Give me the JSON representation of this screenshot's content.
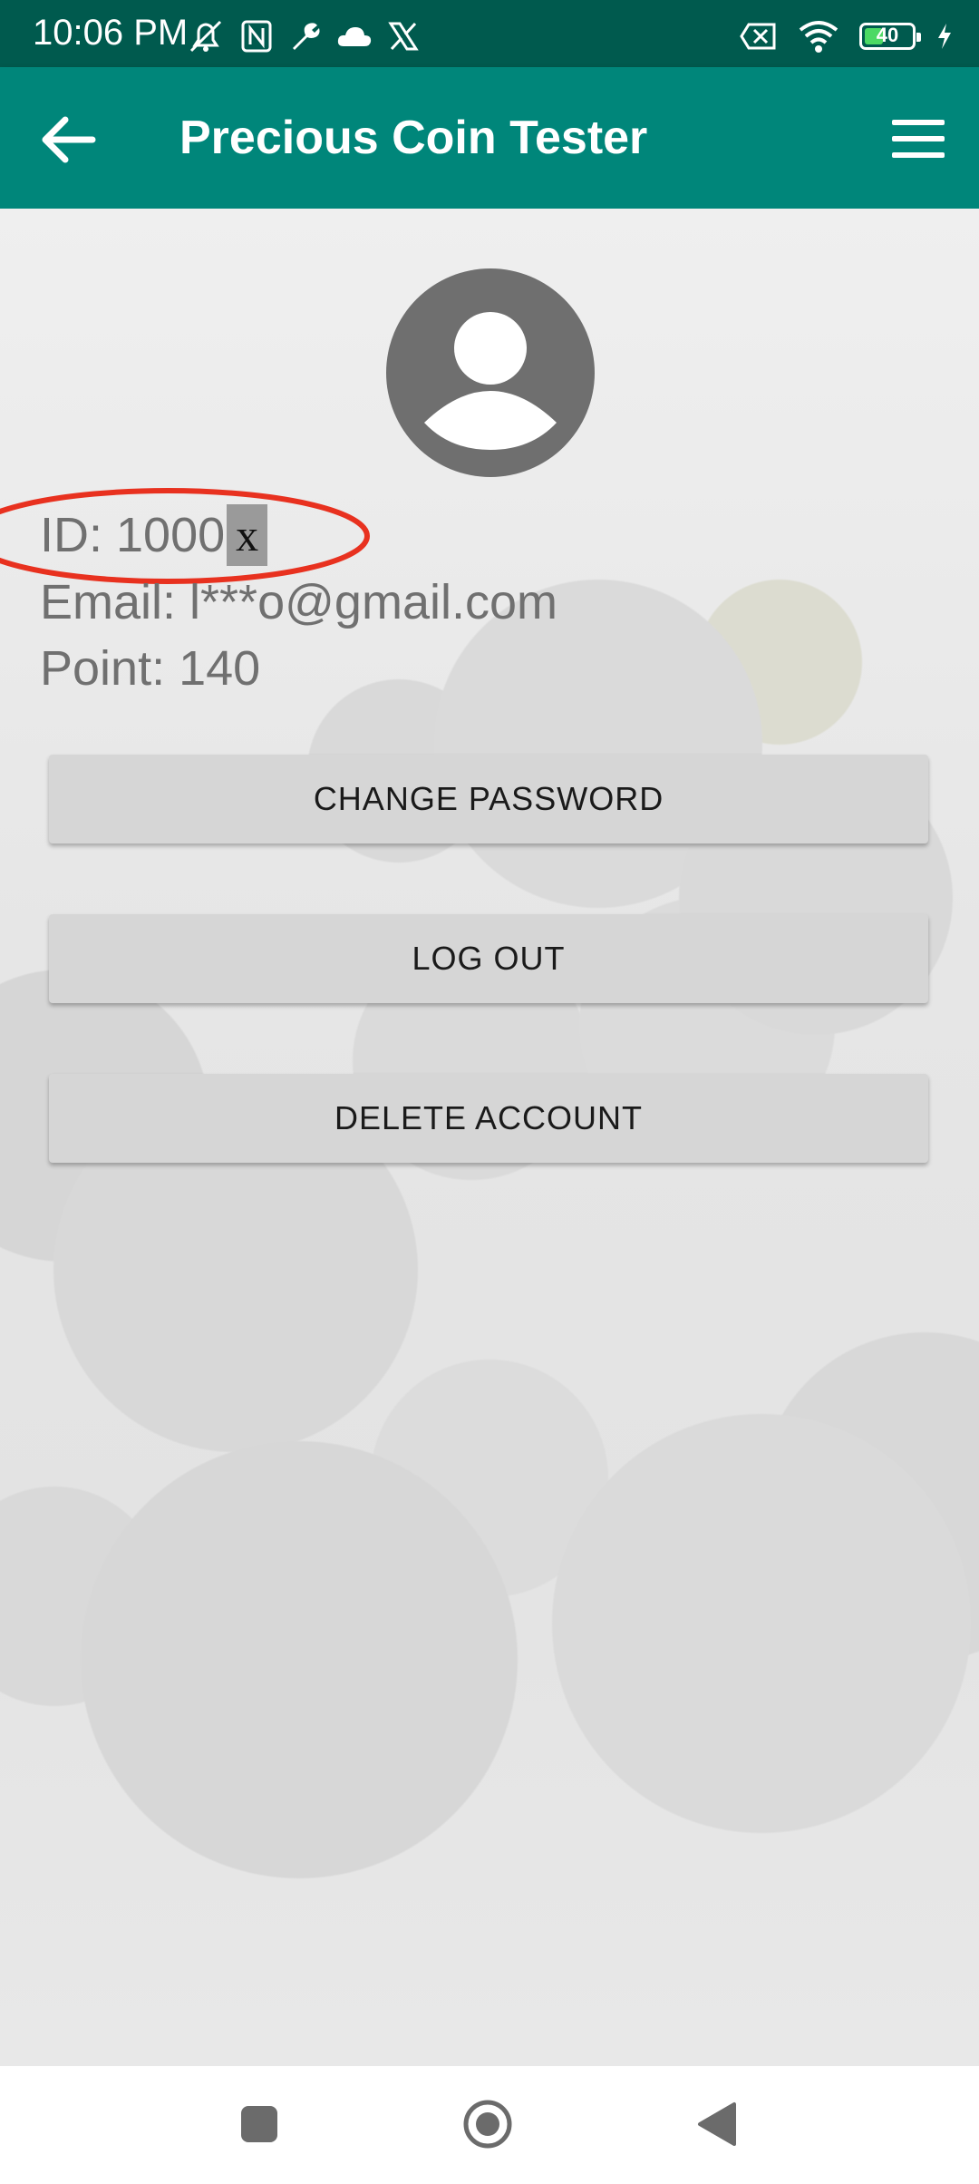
{
  "status_bar": {
    "time": "10:06 PM",
    "battery_level": "40",
    "left_icons": [
      "silent-bell-icon",
      "nfc-icon",
      "wrench-icon",
      "cloud-icon",
      "x-logo-icon"
    ],
    "right_icons": [
      "no-sim-icon",
      "wifi-icon",
      "battery-icon",
      "charging-bolt-icon"
    ]
  },
  "app_bar": {
    "title": "Precious Coin Tester",
    "back_icon": "arrow-back-icon",
    "menu_icon": "hamburger-menu-icon",
    "background_color": "#00867a"
  },
  "profile": {
    "avatar_icon": "account-circle-icon",
    "id_label": "ID: 1000",
    "id_redacted": "x",
    "email_label": "Email: l***o@gmail.com",
    "point_label": "Point: 140"
  },
  "buttons": {
    "change_password": "CHANGE PASSWORD",
    "log_out": "LOG OUT",
    "delete_account": "DELETE ACCOUNT"
  },
  "nav_bar": {
    "icons": [
      "recents-square-icon",
      "home-circle-icon",
      "back-triangle-icon"
    ]
  }
}
